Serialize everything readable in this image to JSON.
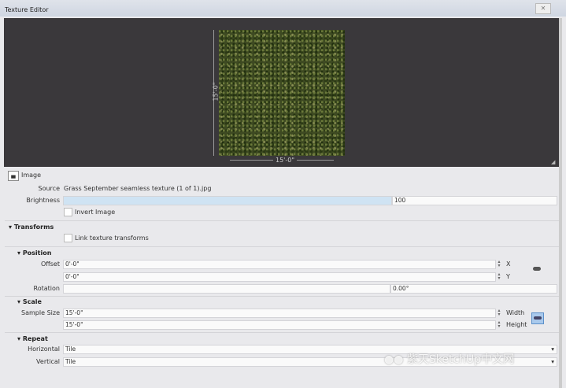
{
  "window": {
    "title": "Texture Editor",
    "close_icon": "close-icon"
  },
  "preview": {
    "width_label": "15'-0\"",
    "height_label": "15'-0\""
  },
  "image": {
    "heading": "Image",
    "source_label": "Source",
    "source_value": "Grass September seamless texture (1 of 1).jpg",
    "brightness_label": "Brightness",
    "brightness_value": "100",
    "invert_label": "Invert Image"
  },
  "transforms": {
    "heading": "Transforms",
    "link_label": "Link texture transforms"
  },
  "position": {
    "heading": "Position",
    "offset_label": "Offset",
    "offset_x": "0'-0\"",
    "offset_y": "0'-0\"",
    "x_label": "X",
    "y_label": "Y",
    "rotation_label": "Rotation",
    "rotation_value": "0.00°"
  },
  "scale": {
    "heading": "Scale",
    "sample_label": "Sample Size",
    "width_value": "15'-0\"",
    "height_value": "15'-0\"",
    "width_label": "Width",
    "height_label": "Height"
  },
  "repeat": {
    "heading": "Repeat",
    "horizontal_label": "Horizontal",
    "horizontal_value": "Tile",
    "vertical_label": "Vertical",
    "vertical_value": "Tile"
  },
  "watermark": "紫天SketchUp中文网"
}
